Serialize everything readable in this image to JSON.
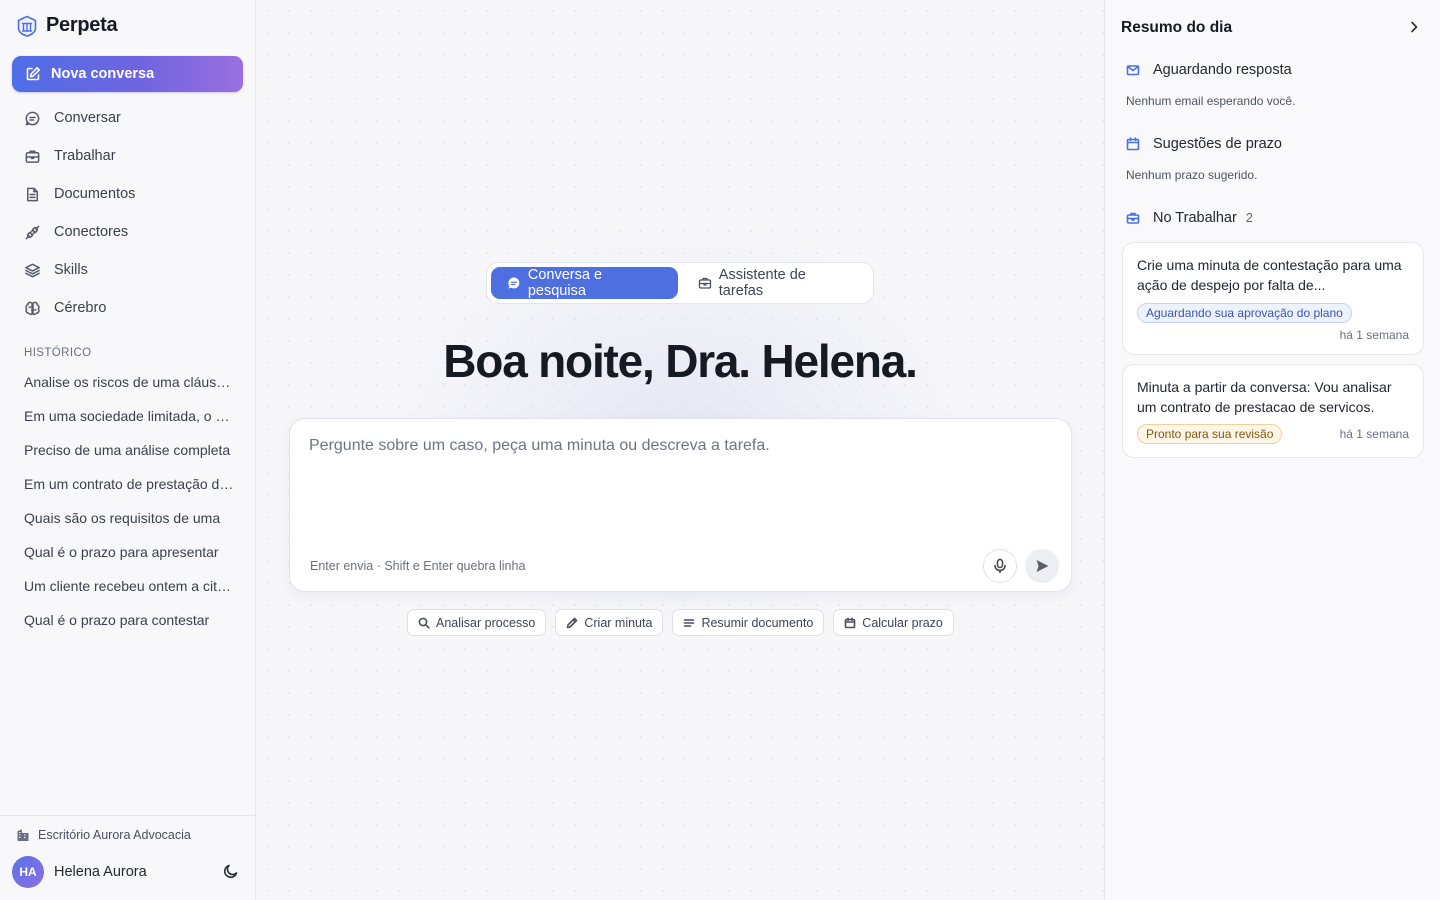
{
  "sidebar": {
    "brand": "Perpeta",
    "new_chat": "Nova conversa",
    "nav": [
      {
        "label": "Conversar",
        "icon": "chat-icon"
      },
      {
        "label": "Trabalhar",
        "icon": "briefcase-icon"
      },
      {
        "label": "Documentos",
        "icon": "document-icon"
      },
      {
        "label": "Conectores",
        "icon": "plug-icon"
      },
      {
        "label": "Skills",
        "icon": "layers-icon"
      },
      {
        "label": "Cérebro",
        "icon": "brain-icon"
      }
    ],
    "history_title": "HISTÓRICO",
    "history": [
      "Analise os riscos de uma cláusula",
      "Em uma sociedade limitada, o sócio",
      "Preciso de uma análise completa",
      "Em um contrato de prestação de serviços",
      "Quais são os requisitos de uma",
      "Qual é o prazo para apresentar",
      "Um cliente recebeu ontem a citação",
      "Qual é o prazo para contestar"
    ],
    "office": "Escritório Aurora Advocacia",
    "user": {
      "initials": "HA",
      "name": "Helena Aurora"
    }
  },
  "main": {
    "modes": [
      "Conversa e pesquisa",
      "Assistente de tarefas"
    ],
    "active_mode": "Conversa e pesquisa",
    "greeting": "Boa noite, Dra. Helena.",
    "composer": {
      "placeholder": "Pergunte sobre um caso, peça uma minuta ou descreva a tarefa.",
      "value": "",
      "hint": "Enter envia · Shift e Enter quebra linha"
    },
    "chips": [
      {
        "label": "Analisar processo",
        "icon": "search-icon"
      },
      {
        "label": "Criar minuta",
        "icon": "pen-icon"
      },
      {
        "label": "Resumir documento",
        "icon": "lines-icon"
      },
      {
        "label": "Calcular prazo",
        "icon": "calendar-icon"
      }
    ]
  },
  "right": {
    "title": "Resumo do dia",
    "sections": {
      "awaiting": {
        "title": "Aguardando resposta",
        "empty": "Nenhum email esperando você."
      },
      "deadlines": {
        "title": "Sugestões de prazo",
        "empty": "Nenhum prazo sugerido."
      },
      "work": {
        "title": "No Trabalhar",
        "count": "2"
      }
    },
    "tasks": [
      {
        "text": "Crie uma minuta de contestação para uma ação de despejo por falta de...",
        "status": "Aguardando sua aprovação do plano",
        "time": "há 1 semana"
      },
      {
        "text": "Minuta a partir da conversa: Vou analisar um contrato de prestacao de servicos.",
        "status": "Pronto para sua revisão",
        "time": "há 1 semana"
      }
    ]
  },
  "colors": {
    "accent": "#4e6fe0",
    "gradient_end": "#9a6fe0",
    "badge_blue": "#3b55b5",
    "badge_amber": "#7b5a12"
  }
}
